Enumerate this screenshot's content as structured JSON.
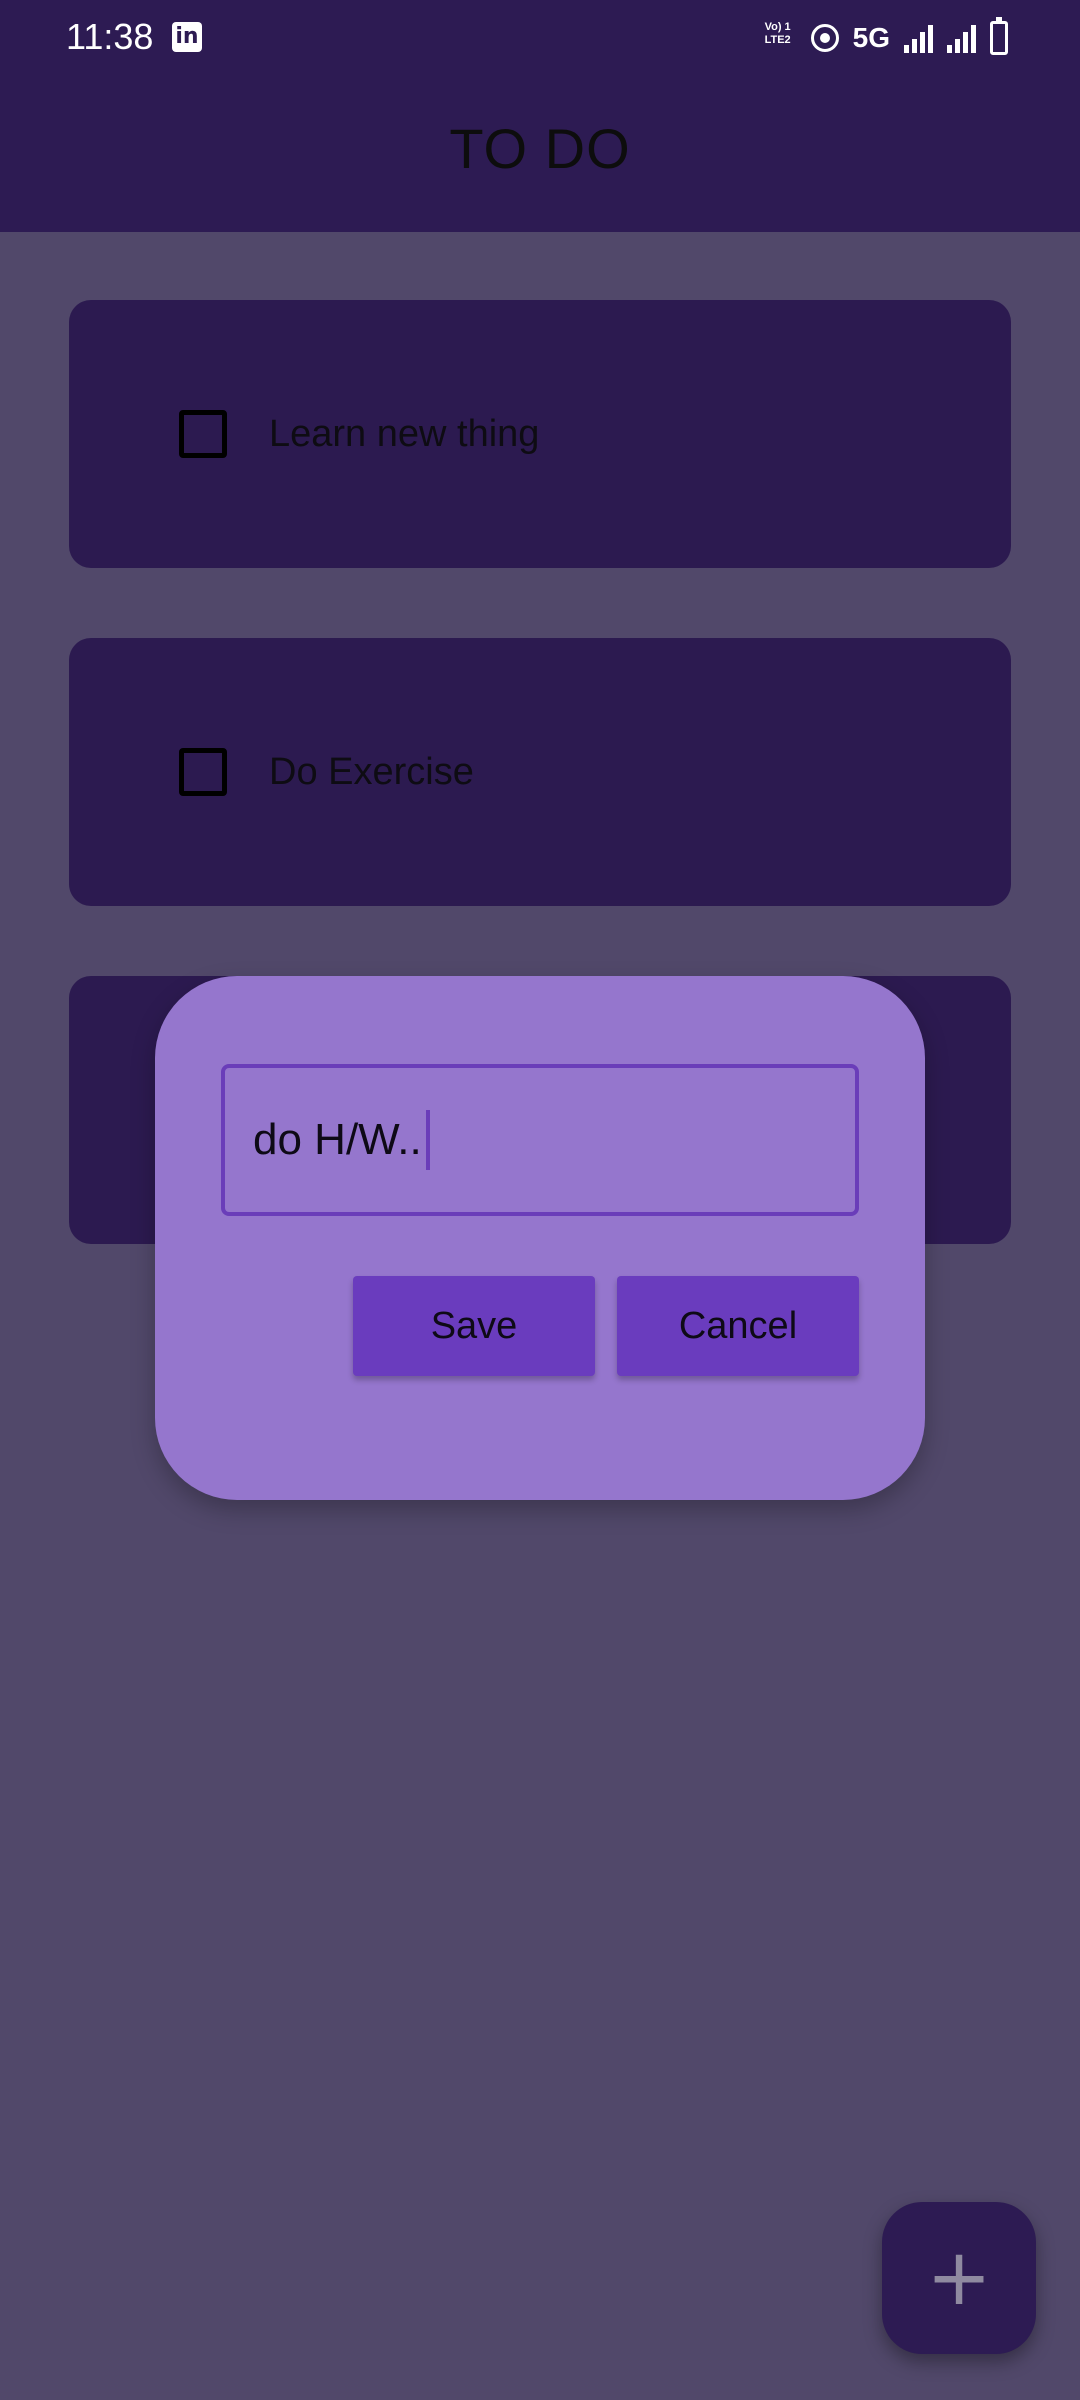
{
  "status_bar": {
    "time": "11:38",
    "network_label": "5G",
    "volte_label_line1": "Vo) 1",
    "volte_label_line2": "LTE2",
    "icons": [
      "linkedin-icon",
      "volte-icon",
      "hotspot-icon",
      "signal-icon",
      "signal-icon",
      "battery-charging-icon"
    ]
  },
  "app_bar": {
    "title": "TO DO"
  },
  "tasks": [
    {
      "label": "Learn new thing",
      "checked": false
    },
    {
      "label": "Do Exercise",
      "checked": false
    },
    {
      "label": "",
      "checked": false
    }
  ],
  "dialog": {
    "input_value": "do H/W..",
    "save_label": "Save",
    "cancel_label": "Cancel"
  },
  "fab": {
    "icon": "plus-icon",
    "symbol": "+"
  },
  "colors": {
    "appbar": "#2d1b53",
    "scrim_background": "#51486a",
    "card": "#2c1a50",
    "dialog": "#9576cd",
    "accent": "#6a3cbe"
  }
}
